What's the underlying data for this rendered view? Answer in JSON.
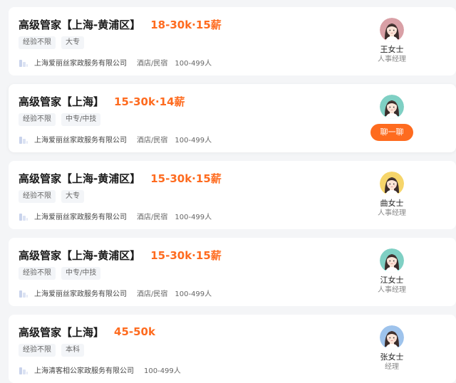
{
  "jobs": [
    {
      "title": "高级管家【上海-黄浦区】",
      "salary": "18-30k·15薪",
      "tags": [
        "经验不限",
        "大专"
      ],
      "company": "上海爱丽丝家政服务有限公司",
      "industry": "酒店/民宿",
      "size": "100-499人",
      "recruiter_name": "王女士",
      "recruiter_title": "人事经理",
      "avatar_bg": "#d9a0a6"
    },
    {
      "title": "高级管家【上海】",
      "salary": "15-30k·14薪",
      "tags": [
        "经验不限",
        "中专/中技"
      ],
      "company": "上海爱丽丝家政服务有限公司",
      "industry": "酒店/民宿",
      "size": "100-499人",
      "chat_label": "聊一聊",
      "avatar_bg": "#7fd0c4"
    },
    {
      "title": "高级管家【上海-黄浦区】",
      "salary": "15-30k·15薪",
      "tags": [
        "经验不限",
        "大专"
      ],
      "company": "上海爱丽丝家政服务有限公司",
      "industry": "酒店/民宿",
      "size": "100-499人",
      "recruiter_name": "曲女士",
      "recruiter_title": "人事经理",
      "avatar_bg": "#f6d56a"
    },
    {
      "title": "高级管家【上海-黄浦区】",
      "salary": "15-30k·15薪",
      "tags": [
        "经验不限",
        "中专/中技"
      ],
      "company": "上海爱丽丝家政服务有限公司",
      "industry": "酒店/民宿",
      "size": "100-499人",
      "recruiter_name": "江女士",
      "recruiter_title": "人事经理",
      "avatar_bg": "#7fd0c4"
    },
    {
      "title": "高级管家【上海】",
      "salary": "45-50k",
      "tags": [
        "经验不限",
        "本科"
      ],
      "company": "上海清客相公家政服务有限公司",
      "industry": "",
      "size": "100-499人",
      "recruiter_name": "张女士",
      "recruiter_title": "经理",
      "avatar_bg": "#9ec3ec"
    }
  ],
  "colors": {
    "salary": "#fe6b1f",
    "chat_button": "#fe6b1f",
    "card_bg": "#ffffff",
    "page_bg": "#f4f5f7"
  },
  "icons": {
    "company_logo": "company-logo-icon",
    "avatar": "female-avatar-icon"
  }
}
